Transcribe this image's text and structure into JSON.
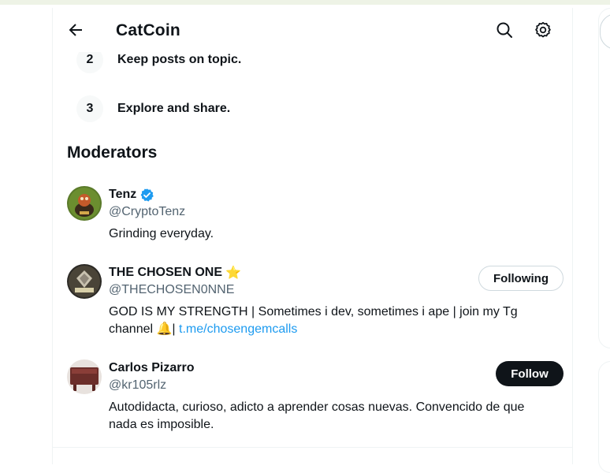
{
  "header": {
    "title": "CatCoin"
  },
  "rules": [
    {
      "number": "2",
      "text": "Keep posts on topic."
    },
    {
      "number": "3",
      "text": "Explore and share."
    }
  ],
  "moderators_title": "Moderators",
  "moderators": [
    {
      "name": "Tenz",
      "handle": "@CryptoTenz",
      "bio": "Grinding everyday.",
      "verified": true,
      "button": null
    },
    {
      "name": "THE CHOSEN ONE",
      "name_emoji": "⭐",
      "handle": "@THECHOSEN0NNE",
      "bio_text": "GOD IS MY STRENGTH | Sometimes i dev, sometimes i ape | join my Tg channel ",
      "bio_emoji": "🔔",
      "bio_sep": "| ",
      "bio_link": "t.me/chosengemcalls",
      "button": "Following"
    },
    {
      "name": "Carlos Pizarro",
      "handle": "@kr105rlz",
      "bio": "Autodidacta, curioso, adicto a aprender cosas nuevas. Convencido de que nada es imposible.",
      "button": "Follow"
    }
  ],
  "icons": {
    "back": "arrow-left-icon",
    "search": "search-icon",
    "settings": "gear-icon",
    "verified": "verified-badge-icon"
  },
  "colors": {
    "accent": "#1d9bf0",
    "text": "#0f1419",
    "muted": "#536471",
    "follow_bg": "#0f1419"
  }
}
